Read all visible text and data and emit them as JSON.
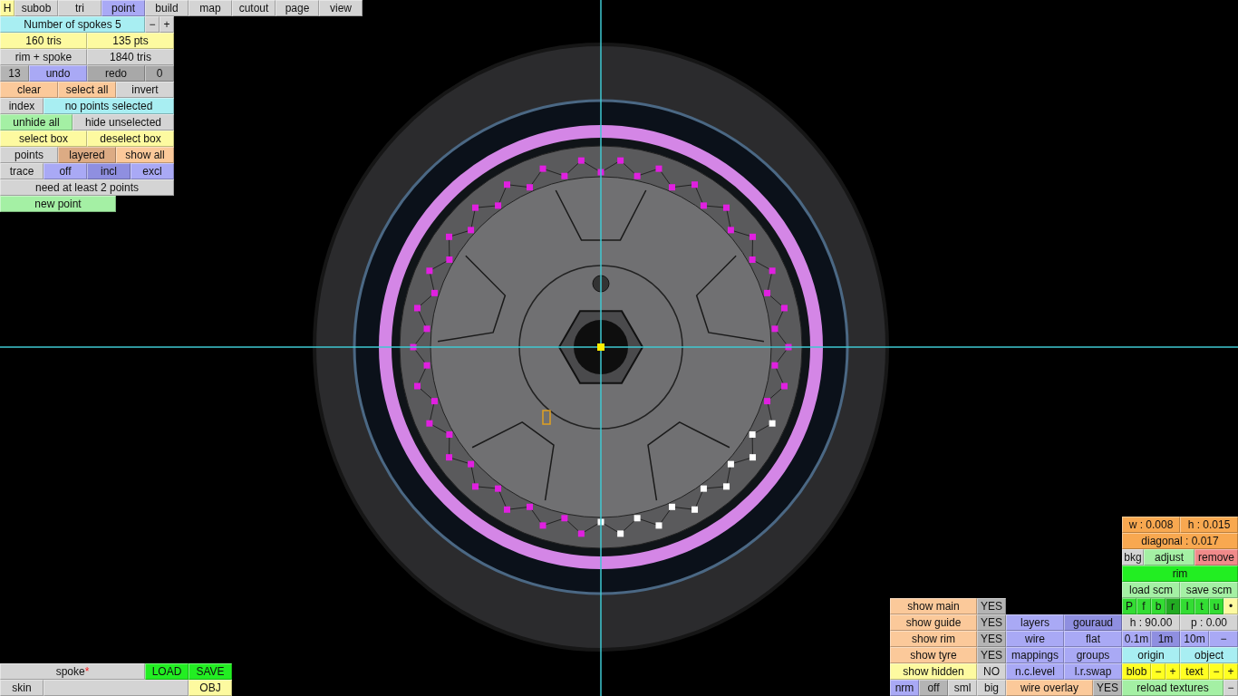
{
  "home_button": {
    "label": "H"
  },
  "tabs": [
    {
      "label": "subob",
      "selected": false
    },
    {
      "label": "tri",
      "selected": false
    },
    {
      "label": "point",
      "selected": true
    },
    {
      "label": "build",
      "selected": false
    },
    {
      "label": "map",
      "selected": false
    },
    {
      "label": "cutout",
      "selected": false
    },
    {
      "label": "page",
      "selected": false
    },
    {
      "label": "view",
      "selected": false
    }
  ],
  "point_panel": [
    [
      {
        "label": "Number of spokes 5",
        "color": "#a8eef2"
      },
      {
        "label": "−",
        "color": "#d4d4d4"
      },
      {
        "label": "+",
        "color": "#d4d4d4"
      }
    ],
    [
      {
        "label": "160 tris",
        "color": "#fdfaa0"
      },
      {
        "label": "135 pts",
        "color": "#fdfaa0"
      }
    ],
    [
      {
        "label": "rim + spoke",
        "color": "#d4d4d4"
      },
      {
        "label": "1840 tris",
        "color": "#d4d4d4"
      }
    ],
    [
      {
        "label": "13",
        "color": "#b4b4b4"
      },
      {
        "label": "undo",
        "color": "#a9a9f5"
      },
      {
        "label": "redo",
        "color": "#a8a8a8"
      },
      {
        "label": "0",
        "color": "#a8a8a8"
      }
    ],
    [
      {
        "label": "clear",
        "color": "#fbc99a"
      },
      {
        "label": "select all",
        "color": "#fbc99a"
      },
      {
        "label": "invert",
        "color": "#d4d4d4"
      }
    ],
    [
      {
        "label": "index",
        "color": "#d4d4d4"
      },
      {
        "label": "no points selected",
        "color": "#a8eef2"
      }
    ],
    [
      {
        "label": "unhide all",
        "color": "#a4f0a4"
      },
      {
        "label": "hide unselected",
        "color": "#d4d4d4"
      }
    ],
    [
      {
        "label": "select box",
        "color": "#fdfaa0"
      },
      {
        "label": "deselect box",
        "color": "#fdfaa0"
      }
    ],
    [
      {
        "label": "points",
        "color": "#d4d4d4"
      },
      {
        "label": "layered",
        "color": "#dcab84"
      },
      {
        "label": "show all",
        "color": "#fbc99a"
      }
    ],
    [
      {
        "label": "trace",
        "color": "#d4d4d4"
      },
      {
        "label": "off",
        "color": "#a9a9f5"
      },
      {
        "label": "incl",
        "color": "#8f8fe0"
      },
      {
        "label": "excl",
        "color": "#a9a9f5"
      }
    ],
    [
      {
        "label": "need at least 2 points",
        "color": "#d4d4d4"
      }
    ],
    [
      {
        "label": "new point",
        "color": "#a4f0a4"
      }
    ]
  ],
  "file_panel": [
    [
      {
        "kind": "button",
        "label": "spoke",
        "modified_mark": "*",
        "color": "#d4d4d4"
      },
      {
        "kind": "button",
        "label": "LOAD",
        "color": "#22ee22"
      },
      {
        "kind": "button",
        "label": "SAVE",
        "color": "#22ee22"
      }
    ],
    [
      {
        "kind": "button",
        "label": "skin",
        "color": "#d4d4d4"
      },
      {
        "kind": "field",
        "color": "#d4d4d4"
      },
      {
        "kind": "button",
        "label": "OBJ",
        "color": "#fdfaa0"
      }
    ]
  ],
  "display_panel": [
    [
      {
        "label": "show main",
        "color": "#fbc99a"
      },
      {
        "label": "YES",
        "color": "#b4b4b4"
      }
    ],
    [
      {
        "label": "show guide",
        "color": "#fbc99a"
      },
      {
        "label": "YES",
        "color": "#b4b4b4"
      }
    ],
    [
      {
        "label": "show rim",
        "color": "#fbc99a"
      },
      {
        "label": "YES",
        "color": "#b4b4b4"
      }
    ],
    [
      {
        "label": "show tyre",
        "color": "#fbc99a"
      },
      {
        "label": "YES",
        "color": "#b4b4b4"
      }
    ],
    [
      {
        "label": "show hidden",
        "color": "#fdfaa0"
      },
      {
        "label": "NO",
        "color": "#d4d4d4"
      }
    ],
    [
      {
        "label": "nrm",
        "color": "#a9a9f5"
      },
      {
        "label": "off",
        "color": "#b4b4b4"
      },
      {
        "label": "sml",
        "color": "#d4d4d4"
      },
      {
        "label": "big",
        "color": "#d4d4d4"
      }
    ]
  ],
  "render_panel": [
    [
      {
        "label": "layers",
        "color": "#a9a9f5"
      },
      {
        "label": "gouraud",
        "color": "#8f8fe0"
      }
    ],
    [
      {
        "label": "wire",
        "color": "#a9a9f5"
      },
      {
        "label": "flat",
        "color": "#a9a9f5"
      }
    ],
    [
      {
        "label": "mappings",
        "color": "#a9a9f5"
      },
      {
        "label": "groups",
        "color": "#a9a9f5"
      }
    ],
    [
      {
        "label": "n.c.level",
        "color": "#a9a9f5"
      },
      {
        "label": "l.r.swap",
        "color": "#a9a9f5"
      }
    ],
    [
      {
        "label": "wire overlay",
        "color": "#fbc99a"
      },
      {
        "label": "YES",
        "color": "#b4b4b4"
      }
    ]
  ],
  "object_panel": [
    [
      {
        "label": "w : 0.008",
        "color": "#f8a850"
      },
      {
        "label": "h : 0.015",
        "color": "#f8a850"
      }
    ],
    [
      {
        "label": "diagonal : 0.017",
        "color": "#f8a850"
      }
    ],
    [
      {
        "label": "bkg",
        "color": "#d4d4d4"
      },
      {
        "label": "adjust",
        "color": "#a4f0a4"
      },
      {
        "label": "remove",
        "color": "#f08a8a"
      }
    ],
    [
      {
        "label": "rim",
        "color": "#22ee22"
      }
    ],
    [
      {
        "label": "load scm",
        "color": "#a4f0a4"
      },
      {
        "label": "save scm",
        "color": "#a4f0a4"
      }
    ],
    [
      {
        "label": "P",
        "color": "#33dd33"
      },
      {
        "label": "f",
        "color": "#33dd33"
      },
      {
        "label": "b",
        "color": "#33dd33"
      },
      {
        "label": "r",
        "color": "#22aa22"
      },
      {
        "label": "l",
        "color": "#33dd33"
      },
      {
        "label": "t",
        "color": "#33dd33"
      },
      {
        "label": "u",
        "color": "#33dd33"
      },
      {
        "label": "•",
        "color": "#fdfaa0"
      }
    ],
    [
      {
        "label": "h : 90.00",
        "color": "#d4d4d4"
      },
      {
        "label": "p : 0.00",
        "color": "#d4d4d4"
      }
    ],
    [
      {
        "label": "0.1m",
        "color": "#a9a9f5"
      },
      {
        "label": "1m",
        "color": "#8f8fe0"
      },
      {
        "label": "10m",
        "color": "#a9a9f5"
      },
      {
        "label": "−",
        "color": "#a9a9f5"
      }
    ],
    [
      {
        "label": "origin",
        "color": "#a8eef2"
      },
      {
        "label": "object",
        "color": "#a8eef2"
      }
    ],
    [
      {
        "label": "blob",
        "color": "#ffff22"
      },
      {
        "label": "−",
        "color": "#ffff22"
      },
      {
        "label": "+",
        "color": "#ffff22"
      },
      {
        "label": "text",
        "color": "#ffff22"
      },
      {
        "label": "−",
        "color": "#ffff22"
      },
      {
        "label": "+",
        "color": "#ffff22"
      }
    ],
    [
      {
        "label": "reload textures",
        "color": "#a4f0a4"
      },
      {
        "label": "−",
        "color": "#d4d4d4"
      }
    ]
  ]
}
